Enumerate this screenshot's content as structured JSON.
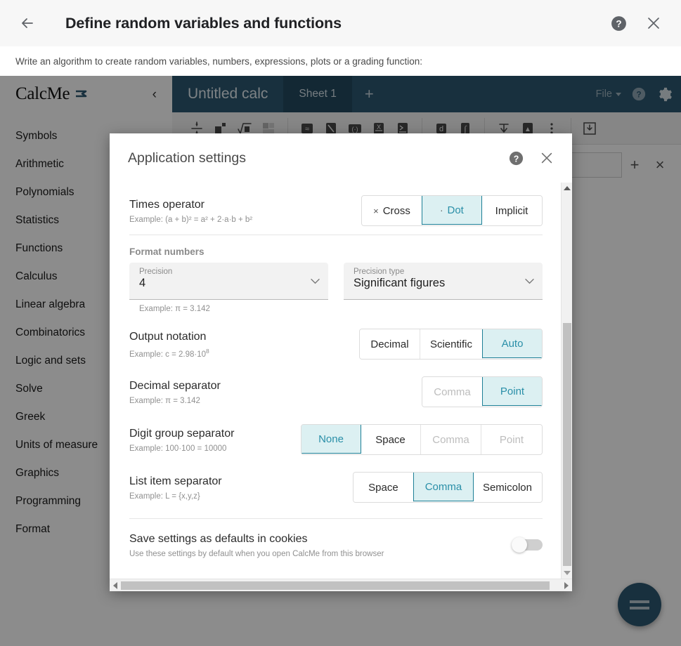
{
  "page": {
    "title": "Define random variables and functions",
    "subtitle": "Write an algorithm to create random variables, numbers, expressions, plots or a grading function:",
    "back_icon": "arrow-left-icon",
    "help_icon": "help-circle-icon",
    "close_icon": "close-icon"
  },
  "calcme": {
    "brand": "CalcMe",
    "collapse_icon": "chevron-left-icon",
    "menu": [
      "Symbols",
      "Arithmetic",
      "Polynomials",
      "Statistics",
      "Functions",
      "Calculus",
      "Linear algebra",
      "Combinatorics",
      "Logic and sets",
      "Solve",
      "Greek",
      "Units of measure",
      "Graphics",
      "Programming",
      "Format"
    ],
    "tabs": {
      "doc_title": "Untitled calc",
      "sheet": "Sheet 1",
      "add": "+"
    },
    "topbar": {
      "file_label": "File",
      "help_icon": "help-circle-icon",
      "settings_icon": "gear-icon"
    },
    "toolbar": [
      {
        "name": "fraction-icon",
        "glyph": "÷"
      },
      {
        "name": "power-icon",
        "glyph": "x▪"
      },
      {
        "name": "square-root-icon",
        "glyph": "√"
      },
      {
        "name": "matrix-icon",
        "glyph": "▤",
        "disabled": true
      },
      {
        "name": "approx-icon",
        "glyph": "≈"
      },
      {
        "name": "evaluate-icon",
        "glyph": "◥"
      },
      {
        "name": "absolute-value-icon",
        "glyph": "(·)"
      },
      {
        "name": "substitute-icon",
        "glyph": "X"
      },
      {
        "name": "define-icon",
        "glyph": "≤"
      },
      {
        "name": "differential-icon",
        "glyph": "d"
      },
      {
        "name": "integral-icon",
        "glyph": "∫"
      },
      {
        "name": "insert-below-icon",
        "glyph": "↓"
      },
      {
        "name": "insert-text-icon",
        "glyph": "⊞"
      },
      {
        "name": "more-options-icon",
        "glyph": "⋮"
      },
      {
        "name": "duplicate-icon",
        "glyph": "⤓"
      }
    ],
    "row_actions": {
      "add": "+",
      "remove": "×"
    },
    "fab_icon": "equals-icon"
  },
  "dialog": {
    "title": "Application settings",
    "help_icon": "help-circle-icon",
    "close_icon": "close-icon",
    "times_operator": {
      "label": "Times operator",
      "example": "Example: (a + b)² = a² + 2·a·b + b²",
      "options": [
        {
          "prefix": "×",
          "label": "Cross",
          "selected": false,
          "disabled": false
        },
        {
          "prefix": "·",
          "label": "Dot",
          "selected": true,
          "disabled": false
        },
        {
          "prefix": "",
          "label": "Implicit",
          "selected": false,
          "disabled": false
        }
      ]
    },
    "format_numbers": {
      "section_title": "Format numbers",
      "precision": {
        "label": "Precision",
        "value": "4",
        "caret": "chevron-down-icon"
      },
      "precision_type": {
        "label": "Precision type",
        "value": "Significant figures",
        "caret": "chevron-down-icon"
      },
      "example": "Example: π = 3.142"
    },
    "output_notation": {
      "label": "Output notation",
      "example_prefix": "Example: c = 2.98·10",
      "example_sup": "8",
      "options": [
        {
          "label": "Decimal",
          "selected": false,
          "disabled": false
        },
        {
          "label": "Scientific",
          "selected": false,
          "disabled": false
        },
        {
          "label": "Auto",
          "selected": true,
          "disabled": false
        }
      ]
    },
    "decimal_separator": {
      "label": "Decimal separator",
      "example": "Example: π = 3.142",
      "options": [
        {
          "label": "Comma",
          "selected": false,
          "disabled": true
        },
        {
          "label": "Point",
          "selected": true,
          "disabled": false
        }
      ]
    },
    "digit_group_separator": {
      "label": "Digit group separator",
      "example": "Example: 100·100 = 10000",
      "options": [
        {
          "label": "None",
          "selected": true,
          "disabled": false
        },
        {
          "label": "Space",
          "selected": false,
          "disabled": false
        },
        {
          "label": "Comma",
          "selected": false,
          "disabled": true
        },
        {
          "label": "Point",
          "selected": false,
          "disabled": true
        }
      ]
    },
    "list_item_separator": {
      "label": "List item separator",
      "example": "Example: L = {x,y,z}",
      "options": [
        {
          "label": "Space",
          "selected": false,
          "disabled": false
        },
        {
          "label": "Comma",
          "selected": true,
          "disabled": false
        },
        {
          "label": "Semicolon",
          "selected": false,
          "disabled": false
        }
      ]
    },
    "save_cookies": {
      "label": "Save settings as defaults in cookies",
      "description": "Use these settings by default when you open CalcMe from this browser",
      "enabled": false
    }
  },
  "colors": {
    "accent_teal": "#1d7f96",
    "selected_fill": "#dcf0f2",
    "topbar_blue": "#2c5871",
    "fab_blue": "#2c5871"
  }
}
